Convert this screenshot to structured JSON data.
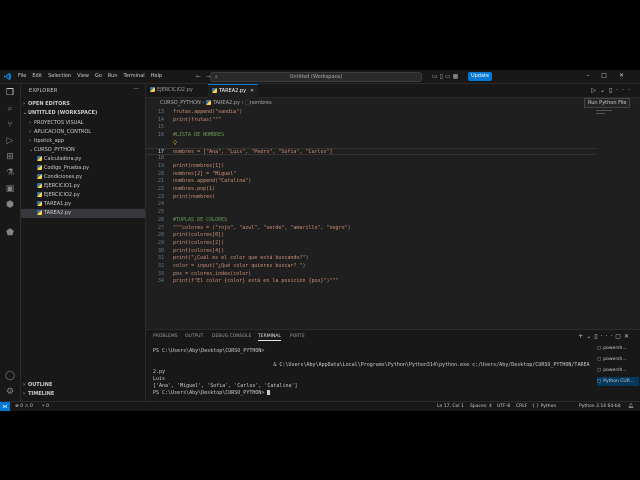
{
  "menu": [
    "File",
    "Edit",
    "Selection",
    "View",
    "Go",
    "Run",
    "Terminal",
    "Help"
  ],
  "command_center": "Untitled (Workspace)",
  "update_label": "Update",
  "tooltip": "Run Python File",
  "sidebar": {
    "title": "EXPLORER",
    "open_editors": "OPEN EDITORS",
    "workspace": "UNTITLED (WORKSPACE)",
    "items": [
      {
        "label": "PROYECTOS VISUAL",
        "kind": "folder",
        "depth": 1,
        "collapsed": true
      },
      {
        "label": "APLICACION_CONTROL",
        "kind": "folder",
        "depth": 1,
        "collapsed": true
      },
      {
        "label": "tipstick_app",
        "kind": "folder",
        "depth": 1,
        "collapsed": true
      },
      {
        "label": "CURSO_PYTHON",
        "kind": "folder",
        "depth": 1,
        "collapsed": false
      },
      {
        "label": "Calculadora.py",
        "kind": "py",
        "depth": 2
      },
      {
        "label": "Codigo_Prueba.py",
        "kind": "py",
        "depth": 2
      },
      {
        "label": "Condiciones.py",
        "kind": "py",
        "depth": 2
      },
      {
        "label": "EJERCICIO1.py",
        "kind": "py",
        "depth": 2
      },
      {
        "label": "EJERCICIO2.py",
        "kind": "py",
        "depth": 2
      },
      {
        "label": "TAREA1.py",
        "kind": "py",
        "depth": 2
      },
      {
        "label": "TAREA2.py",
        "kind": "py",
        "depth": 2,
        "selected": true
      }
    ],
    "outline": "OUTLINE",
    "timeline": "TIMELINE"
  },
  "tabs": [
    {
      "label": "EJERCICIO2.py",
      "active": false
    },
    {
      "label": "TAREA2.py",
      "active": true
    }
  ],
  "breadcrumbs": {
    "parts": [
      "CURSO_PYTHON",
      "TAREA2.py",
      "nombres"
    ]
  },
  "code_lines": [
    {
      "n": "13",
      "text": "frutas.append(\"sandia\")",
      "kind": "plain"
    },
    {
      "n": "14",
      "text": "print(frutas)\"\"\"",
      "kind": "plain"
    },
    {
      "n": "15",
      "text": "",
      "kind": "plain"
    },
    {
      "n": "16",
      "text": "#LISTA DE NOMBRES",
      "kind": "cmt"
    },
    {
      "n": "",
      "text": "",
      "kind": "bulb"
    },
    {
      "n": "17",
      "text": "nombres = [\"Ana\", \"Luis\", \"Pedro\", \"Sofia\", \"Carlos\"]",
      "kind": "plain",
      "current": true
    },
    {
      "n": "18",
      "text": "",
      "kind": "plain"
    },
    {
      "n": "19",
      "text": "print(nombres[1])",
      "kind": "plain"
    },
    {
      "n": "20",
      "text": "nombres[2] = \"Miguel\"",
      "kind": "plain"
    },
    {
      "n": "21",
      "text": "nombres.append(\"Catalina\")",
      "kind": "plain"
    },
    {
      "n": "22",
      "text": "nombres.pop(1)",
      "kind": "plain"
    },
    {
      "n": "23",
      "text": "print(nombres)",
      "kind": "plain"
    },
    {
      "n": "24",
      "text": "",
      "kind": "plain"
    },
    {
      "n": "25",
      "text": "",
      "kind": "plain"
    },
    {
      "n": "26",
      "text": "#TUPLAS DE COLORES",
      "kind": "cmt"
    },
    {
      "n": "27",
      "text": "\"\"\"colores = (\"rojo\", \"azul\", \"verde\", \"amarillo\", \"negro\")",
      "kind": "plain"
    },
    {
      "n": "28",
      "text": "print(colores[0])",
      "kind": "plain"
    },
    {
      "n": "29",
      "text": "print(colores[2])",
      "kind": "plain"
    },
    {
      "n": "30",
      "text": "print(colores[4])",
      "kind": "plain"
    },
    {
      "n": "31",
      "text": "print(\"¿Cuál es el color que está buscando?\")",
      "kind": "plain"
    },
    {
      "n": "32",
      "text": "color = input(\"¿Qué color quieres buscar? \")",
      "kind": "plain"
    },
    {
      "n": "33",
      "text": "pos = colores.index(color)",
      "kind": "plain"
    },
    {
      "n": "34",
      "text": "print(f\"El color {color} está en la posición {pos}\")\"\"\"",
      "kind": "plain"
    }
  ],
  "panel": {
    "tabs": [
      "PROBLEMS",
      "OUTPUT",
      "DEBUG CONSOLE",
      "TERMINAL",
      "PORTS"
    ],
    "active": "TERMINAL",
    "terminal_lines": [
      "PS C:\\Users\\Aby\\Desktop\\CURSO_PYTHON>",
      "",
      "                                        & C:\\Users\\Aby\\AppData\\Local\\Programs\\Python\\Python314\\python.exe c:/Users/Aby/Desktop/CURSO_PYTHON/TAREA",
      "2.py",
      "Luis",
      "['Ana', 'Miguel', 'Sofia', 'Carlos', 'Catalina']",
      "PS C:\\Users\\Aby\\Desktop\\CURSO_PYTHON>"
    ],
    "terminals": [
      {
        "label": "powersh...",
        "selected": false
      },
      {
        "label": "powersh...",
        "selected": false
      },
      {
        "label": "powersh...",
        "selected": false
      },
      {
        "label": "Python CUR...",
        "selected": true
      }
    ]
  },
  "status": {
    "problems": "⊗ 0  ⚠ 0",
    "ports": "⑂ 0",
    "position": "Ln 17, Col 1",
    "spaces": "Spaces: 4",
    "encoding": "UTF-8",
    "eol": "CRLF",
    "language": "{ } Python",
    "interpreter": "Python 3.14 64-bit"
  },
  "colors": {
    "accent": "#0078d4",
    "string": "#ce9178",
    "comment": "#6a9955"
  }
}
